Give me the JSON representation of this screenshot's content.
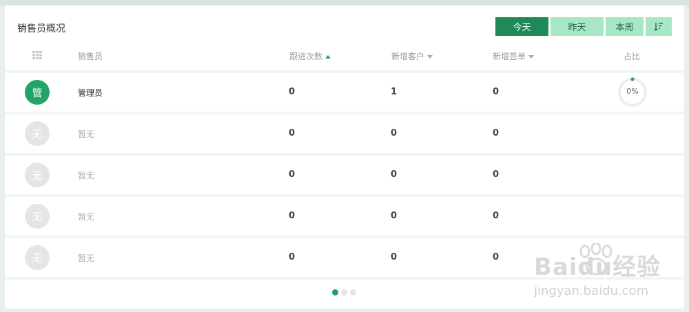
{
  "widget": {
    "title": "销售员概况"
  },
  "filters": {
    "today": "今天",
    "yesterday": "昨天",
    "this_week": "本周"
  },
  "table": {
    "headers": {
      "salesperson": "销售员",
      "follow_count": "跟进次数",
      "new_customers": "新增客户",
      "new_orders": "新增签单",
      "ratio": "占比"
    },
    "rows": [
      {
        "avatar": "管",
        "name": "管理员",
        "follow": "0",
        "customers": "1",
        "orders": "0",
        "ratio": "0%"
      },
      {
        "avatar": "无",
        "name": "暂无",
        "follow": "0",
        "customers": "0",
        "orders": "0"
      },
      {
        "avatar": "无",
        "name": "暂无",
        "follow": "0",
        "customers": "0",
        "orders": "0"
      },
      {
        "avatar": "无",
        "name": "暂无",
        "follow": "0",
        "customers": "0",
        "orders": "0"
      },
      {
        "avatar": "无",
        "name": "暂无",
        "follow": "0",
        "customers": "0",
        "orders": "0"
      }
    ]
  },
  "pagination": {
    "page_count": 3,
    "current_page": 1
  },
  "colors": {
    "accent": "#1d8a57",
    "accent_light": "#a8e6c8",
    "inactive": "#e5e5e5"
  },
  "watermark": {
    "brand": "Baidu经验",
    "url": "jingyan.baidu.com"
  }
}
